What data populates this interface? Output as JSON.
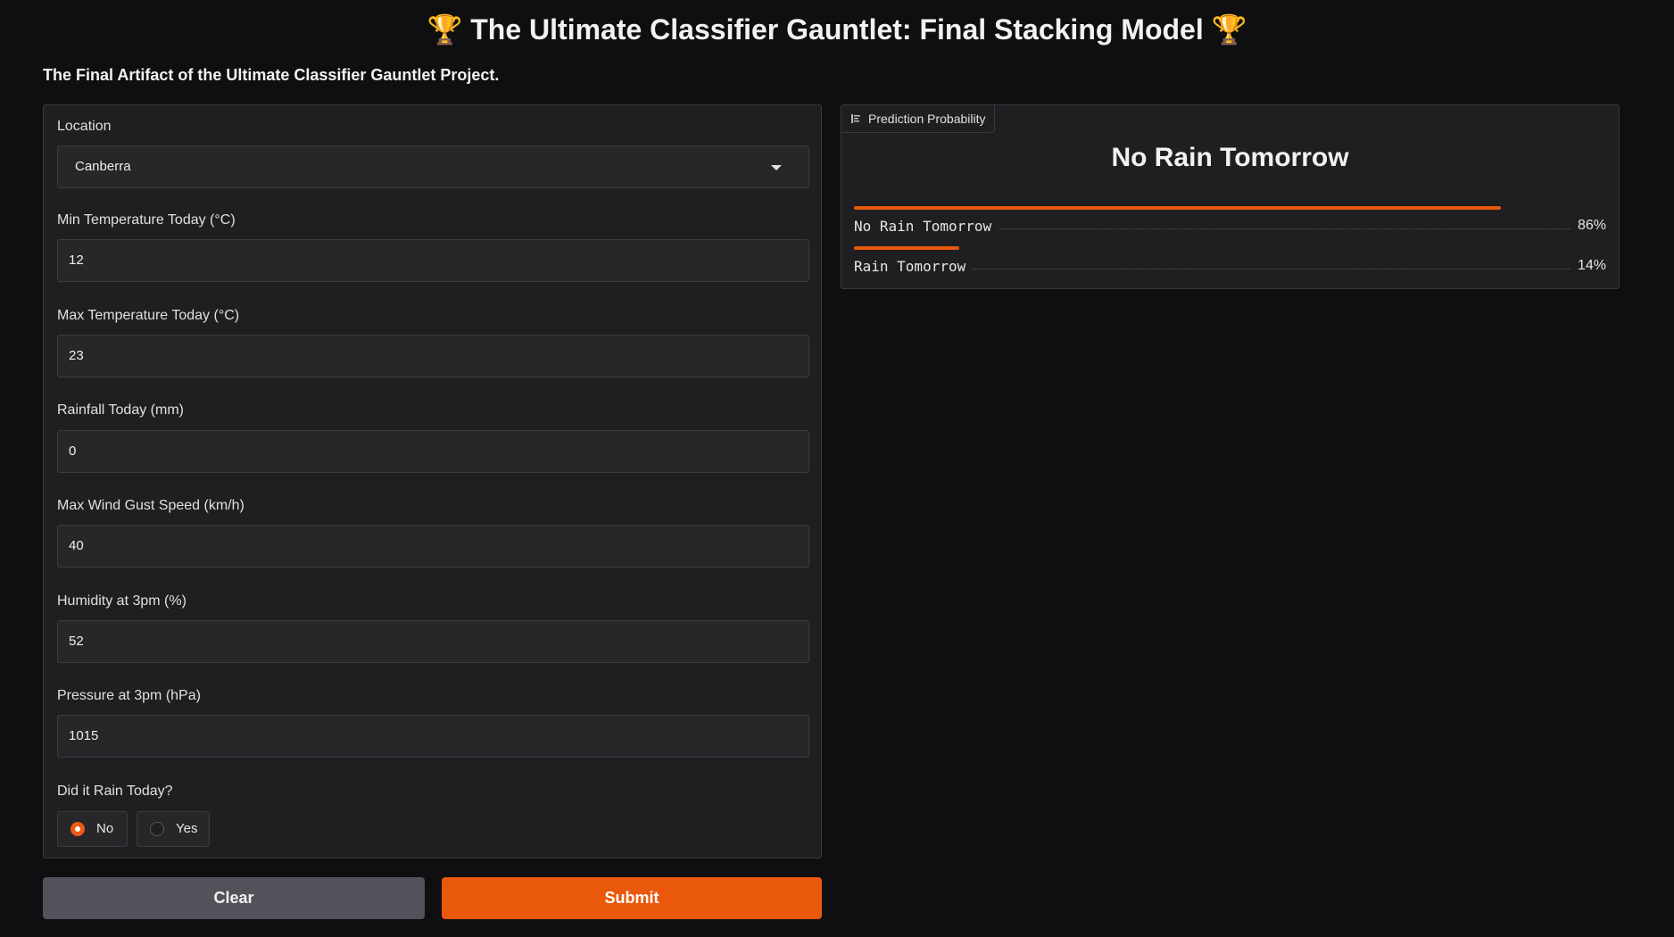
{
  "header": {
    "title": "🏆 The Ultimate Classifier Gauntlet: Final Stacking Model 🏆",
    "description": "The Final Artifact of the Ultimate Classifier Gauntlet Project."
  },
  "form": {
    "location": {
      "label": "Location",
      "value": "Canberra"
    },
    "min_temp": {
      "label": "Min Temperature Today (°C)",
      "value": "12"
    },
    "max_temp": {
      "label": "Max Temperature Today (°C)",
      "value": "23"
    },
    "rainfall": {
      "label": "Rainfall Today (mm)",
      "value": "0"
    },
    "wind_gust": {
      "label": "Max Wind Gust Speed (km/h)",
      "value": "40"
    },
    "humidity": {
      "label": "Humidity at 3pm (%)",
      "value": "52"
    },
    "pressure": {
      "label": "Pressure at 3pm (hPa)",
      "value": "1015"
    },
    "rain_today": {
      "label": "Did it Rain Today?",
      "options": [
        "No",
        "Yes"
      ],
      "selected": "No"
    }
  },
  "buttons": {
    "clear": "Clear",
    "submit": "Submit"
  },
  "output": {
    "tab_label": "Prediction Probability",
    "predicted_label": "No Rain Tomorrow",
    "confidences": [
      {
        "label": "No Rain Tomorrow",
        "percent_text": "86%",
        "fraction": 0.86
      },
      {
        "label": "Rain Tomorrow",
        "percent_text": "14%",
        "fraction": 0.14
      }
    ]
  },
  "colors": {
    "accent": "#ea580c",
    "background": "#0f0f11",
    "panel": "#1f1f22"
  },
  "icons": {
    "dropdown": "chevron-down-icon",
    "result_tab": "label-icon"
  }
}
